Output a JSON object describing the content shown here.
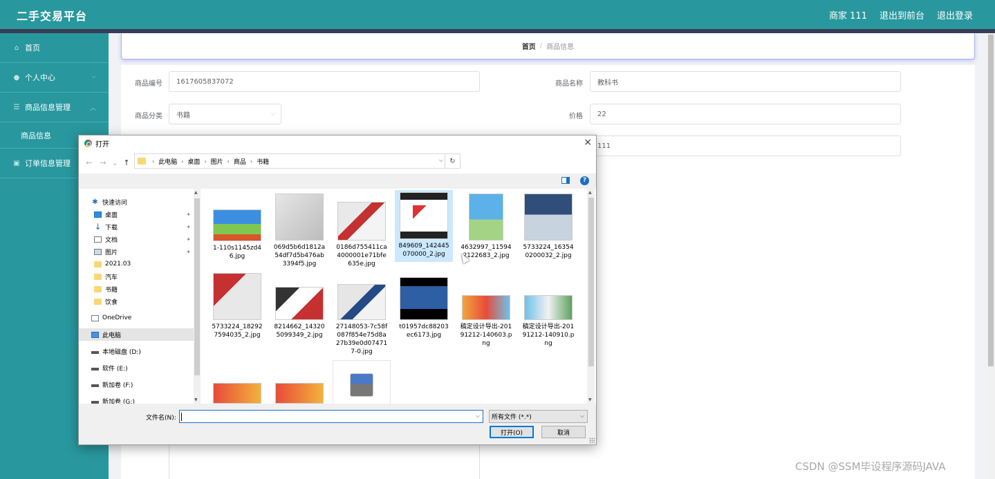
{
  "app": {
    "title": "二手交易平台"
  },
  "topnav": {
    "user": "商家 111",
    "front": "退出到前台",
    "logout": "退出登录"
  },
  "sidebar": {
    "items": [
      {
        "label": "首页",
        "icon": "home-icon"
      },
      {
        "label": "个人中心",
        "icon": "user-icon"
      },
      {
        "label": "商品信息管理",
        "icon": "list-icon"
      },
      {
        "label": "订单信息管理",
        "icon": "clipboard-icon"
      }
    ],
    "sub": "商品信息"
  },
  "breadcrumb": {
    "home": "首页",
    "sep": "/",
    "current": "商品信息"
  },
  "form": {
    "code_label": "商品编号",
    "code_value": "1617605837072",
    "name_label": "商品名称",
    "name_value": "教科书",
    "cat_label": "商品分类",
    "cat_value": "书籍",
    "price_label": "价格",
    "price_value": "22",
    "extra_value": "111"
  },
  "dialog": {
    "title": "打开",
    "close": "×",
    "nav": {
      "back": "←",
      "forward": "→",
      "recent": "⌄",
      "up": "↑"
    },
    "path": [
      "此电脑",
      "桌面",
      "图片",
      "商品",
      "书籍"
    ],
    "tree": [
      {
        "label": "快速访问",
        "icon": "star"
      },
      {
        "label": "桌面",
        "icon": "desk",
        "pin": true
      },
      {
        "label": "下载",
        "icon": "down",
        "pin": true
      },
      {
        "label": "文档",
        "icon": "doc",
        "pin": true
      },
      {
        "label": "图片",
        "icon": "pic",
        "pin": true
      },
      {
        "label": "2021.03",
        "icon": "folder"
      },
      {
        "label": "汽车",
        "icon": "folder"
      },
      {
        "label": "书籍",
        "icon": "folder"
      },
      {
        "label": "饮食",
        "icon": "folder"
      },
      {
        "label": "OneDrive",
        "icon": "cloud"
      },
      {
        "label": "此电脑",
        "icon": "pc"
      },
      {
        "label": "本地磁盘 (D:)",
        "icon": "drive"
      },
      {
        "label": "软件 (E:)",
        "icon": "drive"
      },
      {
        "label": "新加卷 (F:)",
        "icon": "drive"
      },
      {
        "label": "新加卷 (G:)",
        "icon": "drive"
      }
    ],
    "files": [
      "1-110s1145zd46.jpg",
      "069d5b6d1812a54df7d5b476ab3394f5.jpg",
      "0186d755411ca4000001e71bfe635e.jpg",
      "849609_142445070000_2.jpg",
      "4632997_115942122683_2.jpg",
      "5733224_163540200032_2.jpg",
      "5733224_182927594035_2.jpg",
      "8214662_143205099349_2.jpg",
      "27148053-7c58f087f854e75d8a27b39e0d074717-0.jpg",
      "t01957dc88203ec6173.jpg",
      "稿定设计导出-20191212-140603.png",
      "稿定设计导出-20191212-140910.png"
    ],
    "filename_label": "文件名(N):",
    "filename_value": "",
    "filetype": "所有文件 (*.*)",
    "open": "打开(O)",
    "cancel": "取消"
  },
  "watermark": "CSDN @SSM毕设程序源码JAVA"
}
